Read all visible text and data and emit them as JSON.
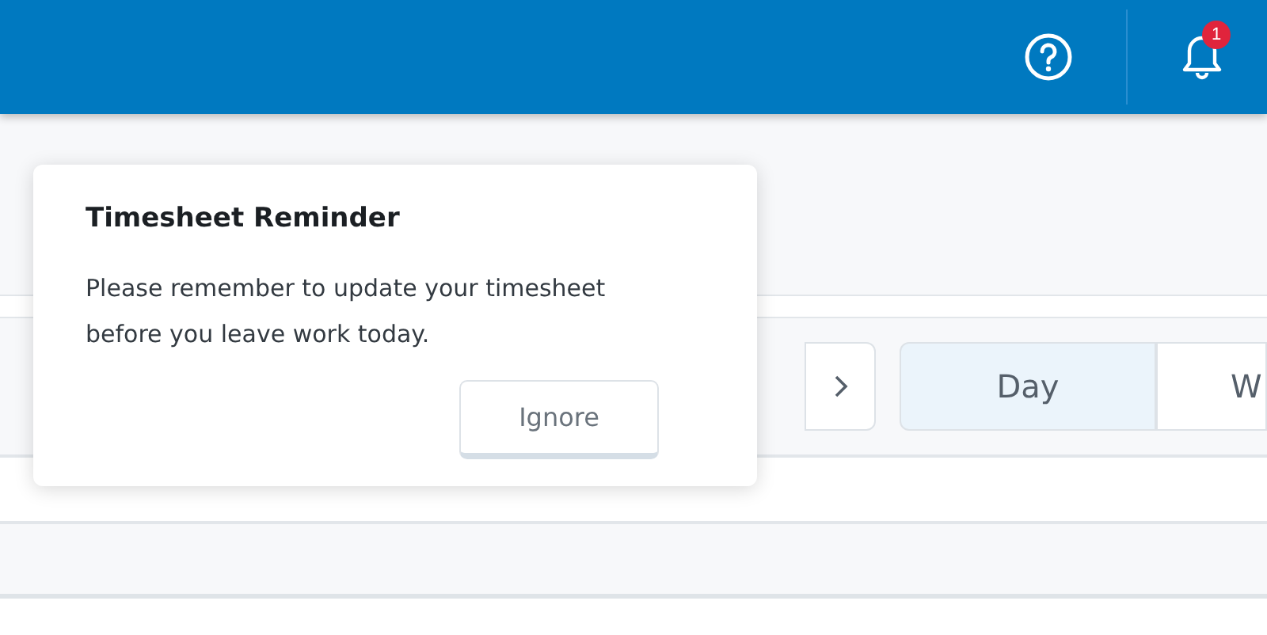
{
  "header": {
    "notification_count": "1"
  },
  "view_tabs": [
    {
      "label": "Day",
      "selected": true
    },
    {
      "label": "W",
      "selected": false
    }
  ],
  "popover": {
    "title": "Timesheet Reminder",
    "message": "Please remember to update your timesheet before you leave work today.",
    "button": "Ignore"
  }
}
